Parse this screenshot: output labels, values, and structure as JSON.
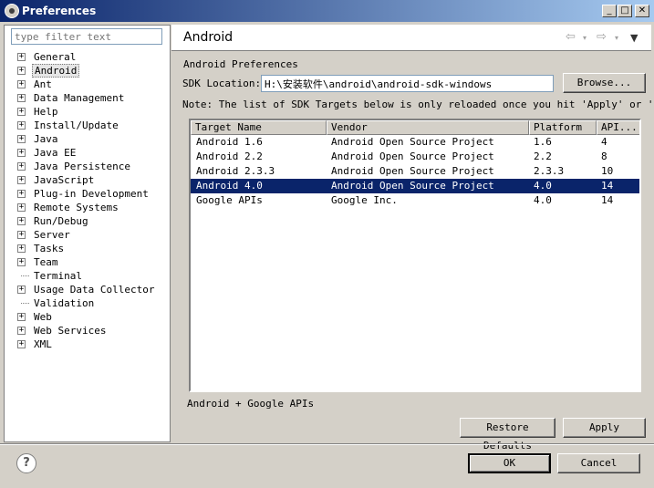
{
  "window": {
    "title": "Preferences"
  },
  "filter": {
    "placeholder": "type filter text"
  },
  "tree": [
    {
      "label": "General",
      "expandable": true,
      "selected": false
    },
    {
      "label": "Android",
      "expandable": true,
      "selected": true
    },
    {
      "label": "Ant",
      "expandable": true,
      "selected": false
    },
    {
      "label": "Data Management",
      "expandable": true,
      "selected": false
    },
    {
      "label": "Help",
      "expandable": true,
      "selected": false
    },
    {
      "label": "Install/Update",
      "expandable": true,
      "selected": false
    },
    {
      "label": "Java",
      "expandable": true,
      "selected": false
    },
    {
      "label": "Java EE",
      "expandable": true,
      "selected": false
    },
    {
      "label": "Java Persistence",
      "expandable": true,
      "selected": false
    },
    {
      "label": "JavaScript",
      "expandable": true,
      "selected": false
    },
    {
      "label": "Plug-in Development",
      "expandable": true,
      "selected": false
    },
    {
      "label": "Remote Systems",
      "expandable": true,
      "selected": false
    },
    {
      "label": "Run/Debug",
      "expandable": true,
      "selected": false
    },
    {
      "label": "Server",
      "expandable": true,
      "selected": false
    },
    {
      "label": "Tasks",
      "expandable": true,
      "selected": false
    },
    {
      "label": "Team",
      "expandable": true,
      "selected": false
    },
    {
      "label": "Terminal",
      "expandable": false,
      "selected": false
    },
    {
      "label": "Usage Data Collector",
      "expandable": true,
      "selected": false
    },
    {
      "label": "Validation",
      "expandable": false,
      "selected": false
    },
    {
      "label": "Web",
      "expandable": true,
      "selected": false
    },
    {
      "label": "Web Services",
      "expandable": true,
      "selected": false
    },
    {
      "label": "XML",
      "expandable": true,
      "selected": false
    }
  ],
  "page": {
    "title": "Android",
    "section_label": "Android Preferences",
    "sdk_label": "SDK Location:",
    "sdk_value": "H:\\安装软件\\android\\android-sdk-windows",
    "browse_label": "Browse...",
    "note": "Note: The list of SDK Targets below is only reloaded once you hit 'Apply' or 'OK'.",
    "table": {
      "headers": [
        "Target Name",
        "Vendor",
        "Platform",
        "API..."
      ],
      "rows": [
        [
          "Android 1.6",
          "Android Open Source Project",
          "1.6",
          "4"
        ],
        [
          "Android 2.2",
          "Android Open Source Project",
          "2.2",
          "8"
        ],
        [
          "Android 2.3.3",
          "Android Open Source Project",
          "2.3.3",
          "10"
        ],
        [
          "Android 4.0",
          "Android Open Source Project",
          "4.0",
          "14"
        ],
        [
          "Google APIs",
          "Google Inc.",
          "4.0",
          "14"
        ]
      ],
      "selected_row": 3
    },
    "target_description": "Android + Google APIs",
    "restore_label": "Restore Defaults",
    "apply_label": "Apply"
  },
  "footer": {
    "ok_label": "OK",
    "cancel_label": "Cancel"
  },
  "colors": {
    "titlebar": "#0a246a",
    "selection": "#0a246a"
  }
}
